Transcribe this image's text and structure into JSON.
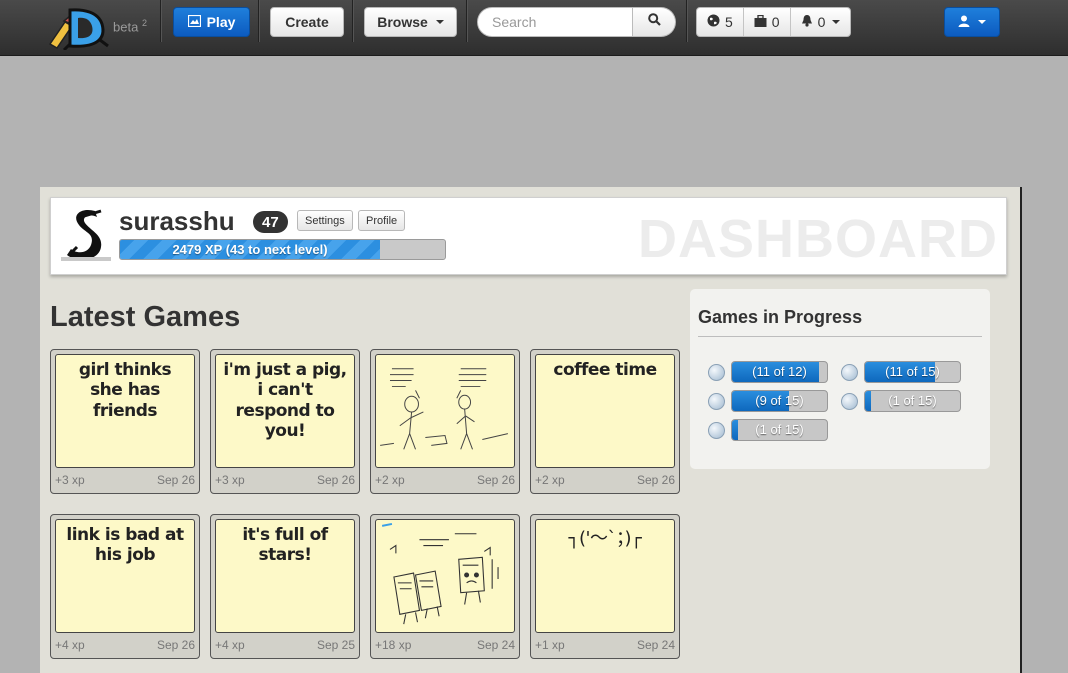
{
  "app": {
    "beta_label": "beta",
    "beta_sup": "2"
  },
  "navbar": {
    "play_label": "Play",
    "create_label": "Create",
    "browse_label": "Browse",
    "search_placeholder": "Search",
    "stats": [
      {
        "icon": "globe-icon",
        "value": "5"
      },
      {
        "icon": "briefcase-icon",
        "value": "0"
      },
      {
        "icon": "bell-icon",
        "value": "0"
      }
    ]
  },
  "profile": {
    "username": "surasshu",
    "level": "47",
    "settings_label": "Settings",
    "profile_label": "Profile",
    "xp_text": "2479 XP (43 to next level)",
    "xp_progress": 0.8,
    "page_heading": "DASHBOARD"
  },
  "latest_games": {
    "title": "Latest Games",
    "items": [
      {
        "text": "girl thinks she has friends",
        "xp": "+3 xp",
        "date": "Sep 26",
        "kind": "text"
      },
      {
        "text": "i'm just a pig, i can't respond to you!",
        "xp": "+3 xp",
        "date": "Sep 26",
        "kind": "text"
      },
      {
        "text": "",
        "xp": "+2 xp",
        "date": "Sep 26",
        "kind": "drawing-1"
      },
      {
        "text": "coffee time",
        "xp": "+2 xp",
        "date": "Sep 26",
        "kind": "text"
      },
      {
        "text": "link is bad at his job",
        "xp": "+4 xp",
        "date": "Sep 26",
        "kind": "text"
      },
      {
        "text": "it's full of stars!",
        "xp": "+4 xp",
        "date": "Sep 25",
        "kind": "text"
      },
      {
        "text": "",
        "xp": "+18 xp",
        "date": "Sep 24",
        "kind": "drawing-2"
      },
      {
        "text": "┐('～`；)┌",
        "xp": "+1 xp",
        "date": "Sep 24",
        "kind": "text"
      }
    ]
  },
  "games_in_progress": {
    "title": "Games in Progress",
    "items": [
      {
        "label": "(11 of 12)",
        "progress": 0.917
      },
      {
        "label": "(11 of 15)",
        "progress": 0.733
      },
      {
        "label": "(9 of 15)",
        "progress": 0.6
      },
      {
        "label": "(1 of 15)",
        "progress": 0.067
      },
      {
        "label": "(1 of 15)",
        "progress": 0.067
      }
    ]
  },
  "colors": {
    "primary": "#0c5bc0",
    "navbar": "#3a3a3a",
    "panel": "#e1e0d8",
    "tile_paper": "#fdf9c8"
  }
}
